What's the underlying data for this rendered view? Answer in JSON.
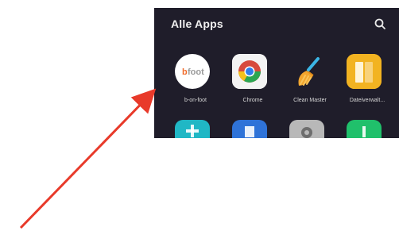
{
  "drawer": {
    "title": "Alle Apps",
    "search_icon": "search-icon"
  },
  "apps": [
    {
      "label": "b-on-foot",
      "icon": "b-on-foot-logo",
      "bg": "#ffffff",
      "accent": "#f06b2a",
      "text": "#9a9a9a"
    },
    {
      "label": "Chrome",
      "icon": "chrome-logo",
      "bg": "#f0f0f0"
    },
    {
      "label": "Clean Master",
      "icon": "broom-icon",
      "bg": "transparent"
    },
    {
      "label": "Dateiverwalt...",
      "icon": "file-manager-icon",
      "bg": "#f2b321"
    }
  ],
  "row2_colors": [
    "#20b7c5",
    "#2f73d8",
    "#b8b8b8",
    "#20c06b"
  ],
  "pointer": {
    "color": "#e83a2a"
  }
}
